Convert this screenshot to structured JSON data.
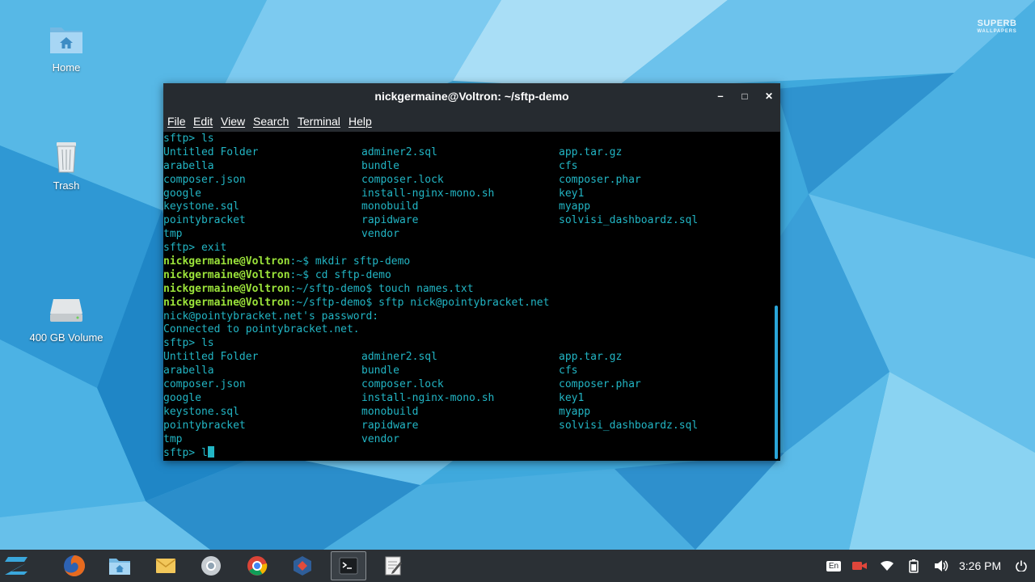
{
  "desktop": {
    "watermark_line1": "SUPERB",
    "watermark_line2": "WALLPAPERS",
    "icons": [
      {
        "label": "Home"
      },
      {
        "label": "Trash"
      },
      {
        "label": "400 GB Volume"
      }
    ]
  },
  "window": {
    "title": "nickgermaine@Voltron: ~/sftp-demo",
    "minimize": "–",
    "maximize": "□",
    "close": "✕",
    "menu": [
      "File",
      "Edit",
      "View",
      "Search",
      "Terminal",
      "Help"
    ]
  },
  "terminal": {
    "sftp_prompt": "sftp> ",
    "cmd_ls": "ls",
    "cmd_exit": "exit",
    "cmd_partial": "l",
    "listing": [
      [
        "Untitled Folder",
        "adminer2.sql",
        "app.tar.gz"
      ],
      [
        "arabella",
        "bundle",
        "cfs"
      ],
      [
        "composer.json",
        "composer.lock",
        "composer.phar"
      ],
      [
        "google",
        "install-nginx-mono.sh",
        "key1"
      ],
      [
        "keystone.sql",
        "monobuild",
        "myapp"
      ],
      [
        "pointybracket",
        "rapidware",
        "solvisi_dashboardz.sql"
      ],
      [
        "tmp",
        "vendor",
        ""
      ]
    ],
    "user_host": "nickgermaine@Voltron",
    "shell_lines": [
      {
        "path": ":~$ ",
        "cmd": "mkdir sftp-demo"
      },
      {
        "path": ":~$ ",
        "cmd": "cd sftp-demo"
      },
      {
        "path": ":~/sftp-demo$ ",
        "cmd": "touch names.txt"
      },
      {
        "path": ":~/sftp-demo$ ",
        "cmd": "sftp nick@pointybracket.net"
      }
    ],
    "password_prompt": "nick@pointybracket.net's password:",
    "connected_msg": "Connected to pointybracket.net."
  },
  "taskbar": {
    "apps": [
      "zorin-menu-icon",
      "firefox-icon",
      "files-icon",
      "mail-icon",
      "chromium-icon",
      "chrome-icon",
      "virtualbox-icon",
      "terminal-icon",
      "text-editor-icon"
    ],
    "keyboard_layout": "En",
    "clock": "3:26 PM"
  },
  "colors": {
    "accent": "#2aa5d8",
    "terminal_text": "#22b5c4",
    "prompt_user": "#9be33a",
    "titlebar": "#262b30"
  }
}
